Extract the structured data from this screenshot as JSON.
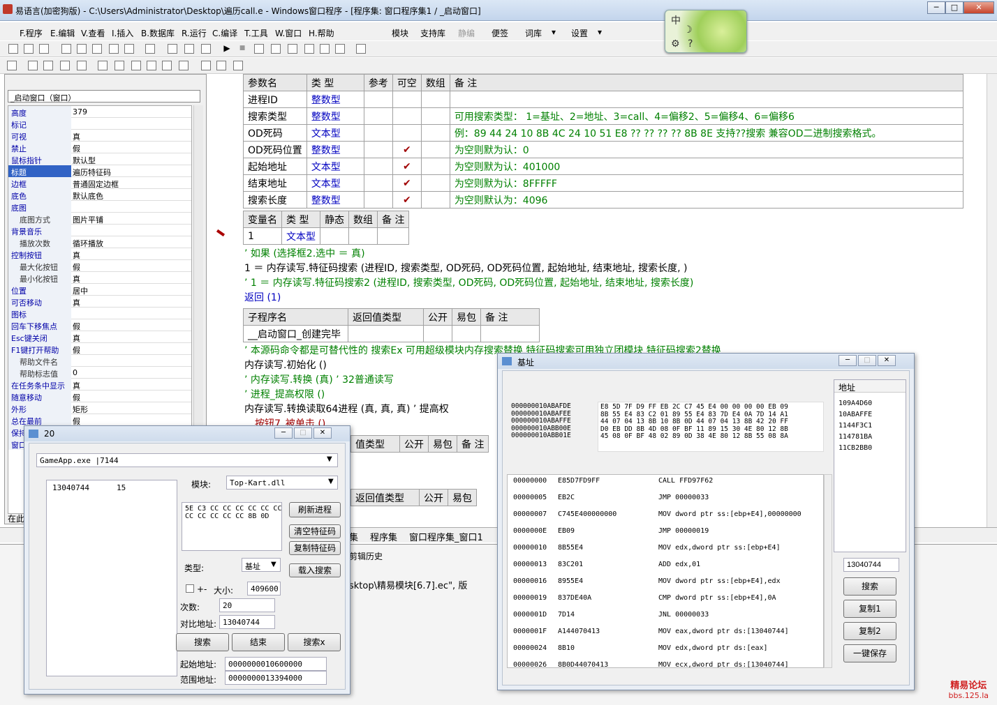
{
  "window": {
    "title": "易语言(加密狗版) - C:\\Users\\Administrator\\Desktop\\遍历call.e - Windows窗口程序 - [程序集: 窗口程序集1 / _启动窗口]",
    "min": "─",
    "max": "□",
    "close": "✕"
  },
  "menu": {
    "items": [
      "F.程序",
      "E.编辑",
      "V.查看",
      "I.插入",
      "B.数据库",
      "R.运行",
      "C.编译",
      "T.工具",
      "W.窗口",
      "H.帮助"
    ],
    "right": [
      "模块",
      "支持库",
      "静编",
      "便签",
      "词库",
      "设置"
    ],
    "extra": "▾"
  },
  "logo": {
    "char1": "中",
    "char2": "☽",
    "char3": "⚙",
    "char4": "?"
  },
  "left_panel": {
    "combo": "_启动窗口（窗口）",
    "status": "在此",
    "props": [
      [
        "高度",
        "379",
        false,
        false
      ],
      [
        "标记",
        "",
        false,
        false
      ],
      [
        "可视",
        "真",
        false,
        false
      ],
      [
        "禁止",
        "假",
        false,
        false
      ],
      [
        "鼠标指针",
        "默认型",
        false,
        false
      ],
      [
        "标题",
        "遍历特征码",
        false,
        true
      ],
      [
        "边框",
        "普通固定边框",
        false,
        false
      ],
      [
        "底色",
        "默认底色",
        false,
        false
      ],
      [
        "底图",
        "",
        false,
        false
      ],
      [
        "底图方式",
        "图片平铺",
        true,
        false
      ],
      [
        "背景音乐",
        "",
        false,
        false
      ],
      [
        "播放次数",
        "循环播放",
        true,
        false
      ],
      [
        "控制按钮",
        "真",
        false,
        false
      ],
      [
        "最大化按钮",
        "假",
        true,
        false
      ],
      [
        "最小化按钮",
        "真",
        true,
        false
      ],
      [
        "位置",
        "居中",
        false,
        false
      ],
      [
        "可否移动",
        "真",
        false,
        false
      ],
      [
        "图标",
        "",
        false,
        false
      ],
      [
        "回车下移焦点",
        "假",
        false,
        false
      ],
      [
        "Esc键关闭",
        "真",
        false,
        false
      ],
      [
        "F1键打开帮助",
        "假",
        false,
        false
      ],
      [
        "帮助文件名",
        "",
        true,
        false
      ],
      [
        "帮助标志值",
        "0",
        true,
        false
      ],
      [
        "在任务条中显示",
        "真",
        false,
        false
      ],
      [
        "随意移动",
        "假",
        false,
        false
      ],
      [
        "外形",
        "矩形",
        false,
        false
      ],
      [
        "总在最前",
        "假",
        false,
        false
      ],
      [
        "保持",
        "",
        false,
        false
      ],
      [
        "窗口",
        "",
        false,
        false
      ]
    ]
  },
  "param_table": {
    "headers": [
      "参数名",
      "类 型",
      "参考",
      "可空",
      "数组",
      "备 注"
    ],
    "rows": [
      [
        "进程ID",
        "整数型",
        "",
        "",
        "",
        ""
      ],
      [
        "搜索类型",
        "整数型",
        "",
        "",
        "",
        "可用搜索类型： 1=基址、2=地址、3=call、4=偏移2、5=偏移4、6=偏移6"
      ],
      [
        "OD死码",
        "文本型",
        "",
        "",
        "",
        "例：89 44 24 10 8B 4C 24 10 51 E8 ?? ?? ?? ?? 8B 8E 支持??搜索 兼容OD二进制搜索格式。"
      ],
      [
        "OD死码位置",
        "整数型",
        "",
        "✔",
        "",
        "为空则默为认：0"
      ],
      [
        "起始地址",
        "文本型",
        "",
        "✔",
        "",
        "为空则默为认：401000"
      ],
      [
        "结束地址",
        "文本型",
        "",
        "✔",
        "",
        "为空则默为认：8FFFFF"
      ],
      [
        "搜索长度",
        "整数型",
        "",
        "✔",
        "",
        "为空则默认为：4096"
      ]
    ]
  },
  "var_table": {
    "headers": [
      "变量名",
      "类 型",
      "静态",
      "数组",
      "备 注"
    ],
    "rows": [
      [
        "1",
        "文本型",
        "",
        "",
        ""
      ]
    ]
  },
  "code1": [
    "’ 如果 (选择框2.选中 ＝ 真)",
    "1 ＝ 内存读写.特征码搜索 (进程ID, 搜索类型, OD死码, OD死码位置, 起始地址, 结束地址, 搜索长度, )",
    "’ 1 ＝ 内存读写.特征码搜索2 (进程ID, 搜索类型, OD死码, OD死码位置, 起始地址, 结束地址, 搜索长度)",
    "返回 (1)"
  ],
  "sub_table": {
    "headers": [
      "子程序名",
      "返回值类型",
      "公开",
      "易包",
      "备 注"
    ],
    "rows": [
      [
        "__启动窗口_创建完毕",
        "",
        "",
        "",
        ""
      ]
    ]
  },
  "code2": [
    "’ 本源码命令都是可替代性的 搜索Ex 可用超级模块内存搜索替换 特征码搜索可用独立团模块 特征码搜索2替换",
    "内存读写.初始化 ()",
    "’ 内存读写.转换 (真) ’ 32普通读写",
    "’ 进程_提高权限 ()",
    "内存读写.转换读取64进程 (真, 真, 真) ’ 提高权",
    "_按钮7_被单击 ()"
  ],
  "sub_table2": {
    "headers": [
      "值类型",
      "公开",
      "易包",
      "备 注"
    ]
  },
  "sub_table3": {
    "headers": [
      "返回值类型",
      "公开",
      "易包"
    ]
  },
  "bottom_tabs": [
    "集",
    "程序集",
    "窗口程序集_窗口1"
  ],
  "output": {
    "tab": "剪辑历史",
    "line": "sktop\\精易模块[6.7].ec\", 版"
  },
  "dlg20": {
    "title": "20",
    "process": "GameApp.exe   |7144",
    "list": [
      [
        "13040744",
        "15"
      ]
    ],
    "module_label": "模块:",
    "module": "Top-Kart.dll",
    "hex": "5E C3 CC CC CC CC CC CC\nCC CC CC CC CC 8B 0D",
    "btn_refresh": "刷新进程",
    "btn_clear": "清空特征码",
    "btn_copy": "复制特征码",
    "btn_load": "载入搜索",
    "type_label": "类型:",
    "type": "基址",
    "chk": "+-",
    "size_label": "大小:",
    "size": "409600",
    "count_label": "次数:",
    "count": "20",
    "cmp_label": "对比地址:",
    "cmp": "13040744",
    "btn_search": "搜索",
    "btn_end": "结束",
    "btn_searchx": "搜索x",
    "start_label": "起始地址:",
    "start": "0000000010600000",
    "range_label": "范围地址:",
    "range": "0000000013394000"
  },
  "dlg_base": {
    "title": "基址",
    "hexaddr": [
      "000000010ABAFDE",
      "000000010ABAFEE",
      "000000010ABAFFE",
      "000000010ABB00E",
      "000000010ABB01E"
    ],
    "hexbytes": [
      "E8 5D 7F D9 FF EB 2C C7 45 E4 00 00 00 00 EB 09",
      "8B 55 E4 83 C2 01 89 55 E4 83 7D E4 0A 7D 14 A1",
      "44 07 04 13 8B 10 8B 0D 44 07 04 13 8B 42 20 FF",
      "D0 EB DD 8B 4D 08 0F BF 11 89 15 30 4E 80 12 8B",
      "45 08 0F BF 48 02 89 0D 38 4E 80 12 8B 55 08 8A"
    ],
    "dasm": [
      [
        "00000000",
        "E85D7FD9FF",
        "CALL FFD97F62"
      ],
      [
        "00000005",
        "EB2C",
        "JMP 00000033"
      ],
      [
        "00000007",
        "C745E400000000",
        "MOV dword ptr ss:[ebp+E4],00000000"
      ],
      [
        "0000000E",
        "EB09",
        "JMP 00000019"
      ],
      [
        "00000010",
        "8B55E4",
        "MOV edx,dword ptr ss:[ebp+E4]"
      ],
      [
        "00000013",
        "83C201",
        "ADD edx,01"
      ],
      [
        "00000016",
        "8955E4",
        "MOV dword ptr ss:[ebp+E4],edx"
      ],
      [
        "00000019",
        "837DE40A",
        "CMP dword ptr ss:[ebp+E4],0A"
      ],
      [
        "0000001D",
        "7D14",
        "JNL 00000033"
      ],
      [
        "0000001F",
        "A144070413",
        "MOV eax,dword ptr ds:[13040744]"
      ],
      [
        "00000024",
        "8B10",
        "MOV edx,dword ptr ds:[eax]"
      ],
      [
        "00000026",
        "8B0D44070413",
        "MOV ecx,dword ptr ds:[13040744]"
      ]
    ],
    "addr_header": "地址",
    "addrs": [
      "109A4D60",
      "10ABAFFE",
      "1144F3C1",
      "114781BA",
      "11CB2BB0"
    ],
    "field": "13040744",
    "btn_search": "搜索",
    "btn_copy1": "复制1",
    "btn_copy2": "复制2",
    "btn_save": "一键保存"
  },
  "watermark": {
    "line1": "精易论坛",
    "line2": "bbs.125.la"
  }
}
